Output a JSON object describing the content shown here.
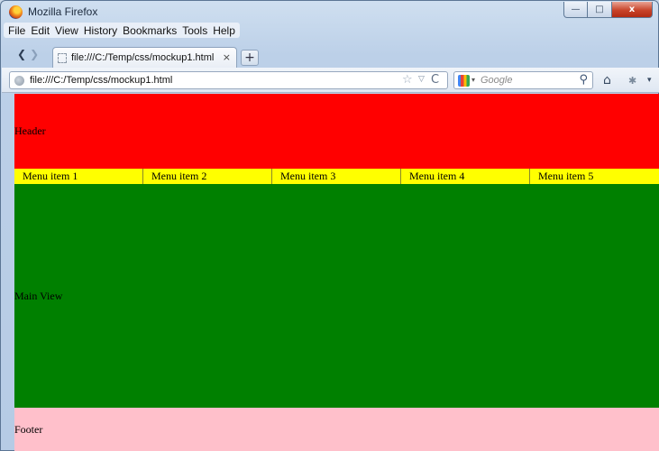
{
  "window": {
    "title": "Mozilla Firefox",
    "minimize_glyph": "—",
    "maximize_glyph": "□",
    "close_glyph": "x"
  },
  "menubar": {
    "items": [
      "File",
      "Edit",
      "View",
      "History",
      "Bookmarks",
      "Tools",
      "Help"
    ]
  },
  "tab": {
    "title": "file:///C:/Temp/css/mockup1.html",
    "close_glyph": "×",
    "new_tab_glyph": "+"
  },
  "nav": {
    "back_glyph": "❮",
    "forward_glyph": "❯",
    "url": "file:///C:/Temp/css/mockup1.html",
    "star_glyph": "☆",
    "drop_glyph": "▽",
    "reload_glyph": "C",
    "search_placeholder": "Google",
    "search_drop_glyph": "▾",
    "magnifier_glyph": "⚲",
    "home_glyph": "⌂",
    "addon_glyph": "✱",
    "more_glyph": "▾"
  },
  "icons": {
    "back": "back-arrow-icon",
    "forward": "forward-arrow-icon",
    "globe": "globe-icon",
    "star": "star-icon",
    "reload": "reload-icon",
    "google": "google-icon",
    "search": "magnifier-icon",
    "home": "home-icon"
  },
  "page": {
    "header_text": "Header",
    "menu_items": [
      "Menu item 1",
      "Menu item 2",
      "Menu item 3",
      "Menu item 4",
      "Menu item 5"
    ],
    "main_text": "Main View",
    "footer_text": "Footer"
  },
  "colors": {
    "header": "#ff0000",
    "menu": "#ffff00",
    "main": "#008000",
    "footer": "#ffc0cb"
  }
}
